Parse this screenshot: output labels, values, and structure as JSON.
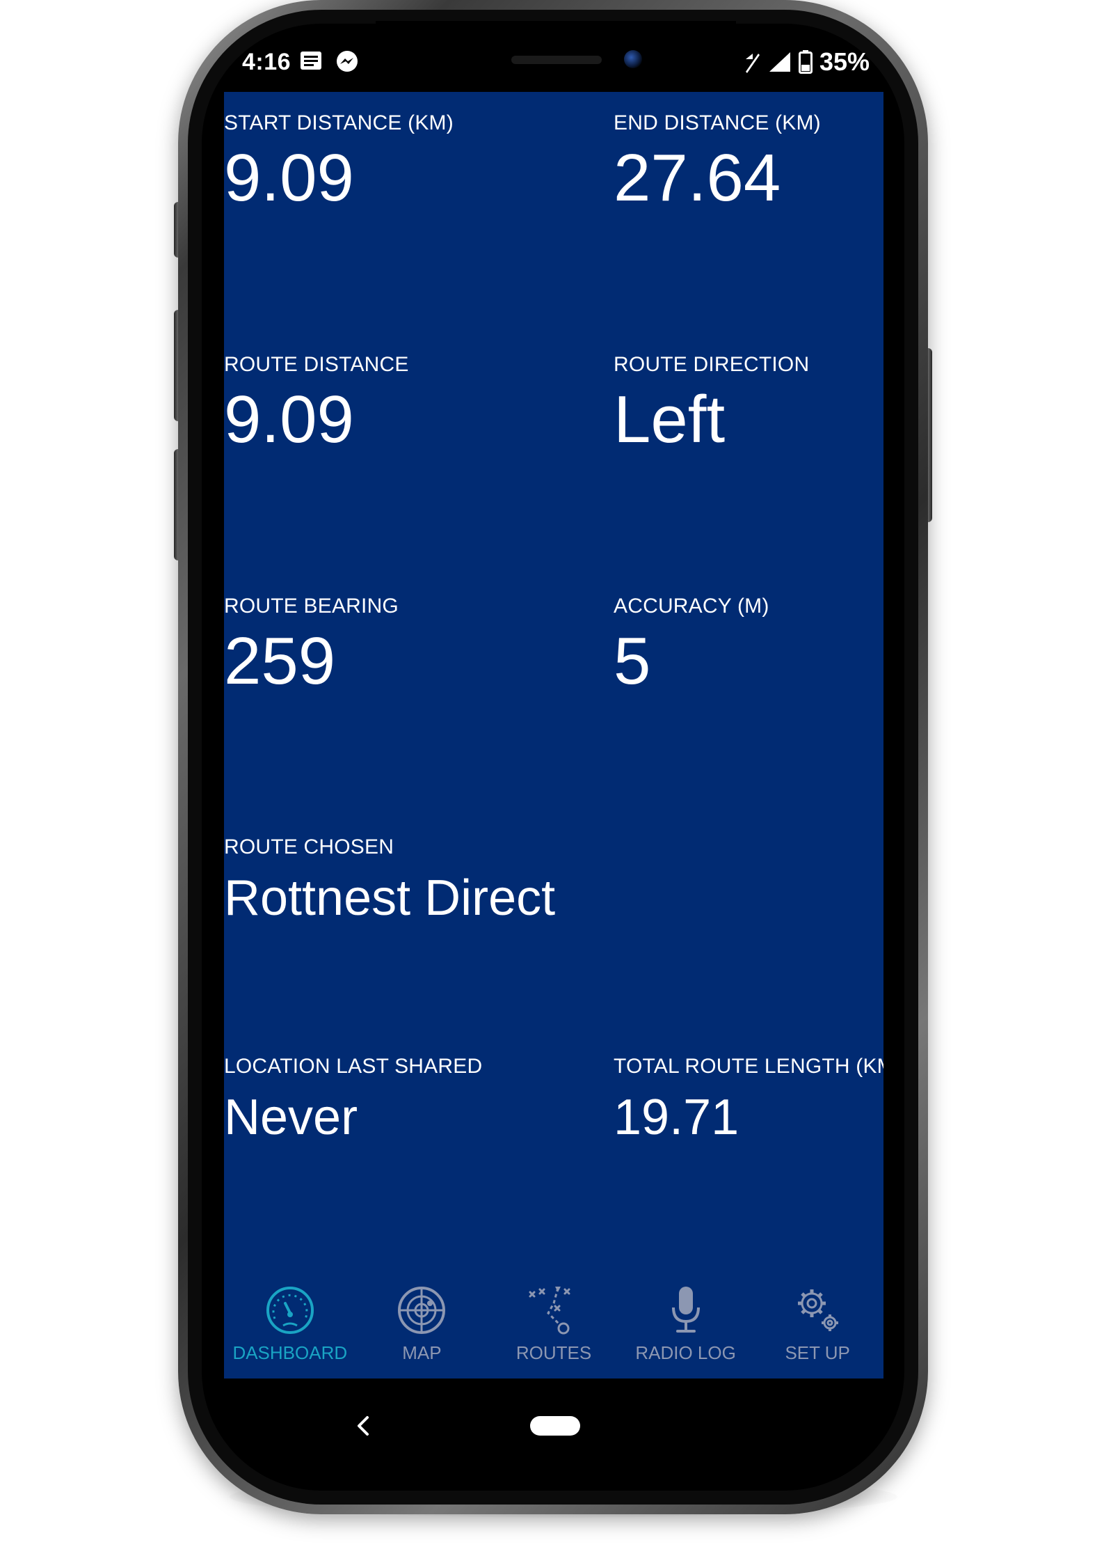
{
  "status_bar": {
    "time": "4:16",
    "battery": "35%",
    "left_icons": [
      "notification-icon",
      "messenger-icon"
    ],
    "right_icons": [
      "no-data-icon",
      "signal-icon",
      "battery-icon"
    ]
  },
  "dashboard": {
    "start_distance": {
      "label": "START DISTANCE (KM)",
      "value": "9.09"
    },
    "end_distance": {
      "label": "END DISTANCE (KM)",
      "value": "27.64"
    },
    "route_distance": {
      "label": "ROUTE DISTANCE",
      "value": "9.09"
    },
    "route_direction": {
      "label": "ROUTE DIRECTION",
      "value": "Left"
    },
    "route_bearing": {
      "label": "ROUTE BEARING",
      "value": "259"
    },
    "accuracy": {
      "label": "ACCURACY (M)",
      "value": "5"
    },
    "route_chosen": {
      "label": "ROUTE CHOSEN",
      "value": "Rottnest Direct"
    },
    "location_last_shared": {
      "label": "LOCATION LAST SHARED",
      "value": "Never"
    },
    "total_route_length": {
      "label": "TOTAL ROUTE LENGTH (KM)",
      "value": "19.71"
    }
  },
  "bottom_nav": {
    "items": [
      {
        "label": "DASHBOARD",
        "icon": "dashboard-gauge-icon",
        "active": true
      },
      {
        "label": "MAP",
        "icon": "radar-map-icon",
        "active": false
      },
      {
        "label": "ROUTES",
        "icon": "route-plan-icon",
        "active": false
      },
      {
        "label": "RADIO LOG",
        "icon": "microphone-icon",
        "active": false
      },
      {
        "label": "SET UP",
        "icon": "gears-icon",
        "active": false
      }
    ]
  },
  "colors": {
    "app_background": "#012B73",
    "active_tab": "#1AA4C4",
    "inactive_tab": "#8C97B2"
  }
}
